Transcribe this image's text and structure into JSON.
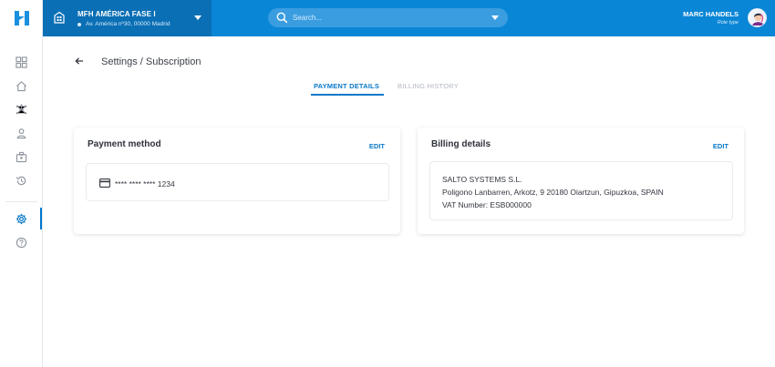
{
  "header": {
    "site_name": "MFH AMÉRICA FASE I",
    "site_address": "Av. América nº30, 00000 Madrid",
    "search_placeholder": "Search...",
    "user_name": "MARC HANDELS",
    "user_role": "Role type"
  },
  "sidebar": {
    "items": [
      {
        "icon": "grid-icon"
      },
      {
        "icon": "home-icon"
      },
      {
        "icon": "network-icon"
      },
      {
        "icon": "user-icon"
      },
      {
        "icon": "badge-icon"
      },
      {
        "icon": "history-icon"
      },
      {
        "icon": "gear-icon",
        "active": true
      },
      {
        "icon": "help-icon"
      }
    ]
  },
  "page": {
    "breadcrumb": "Settings / Subscription",
    "tabs": [
      {
        "label": "PAYMENT DETAILS",
        "active": true
      },
      {
        "label": "BILLING HISTORY",
        "active": false
      }
    ]
  },
  "payment": {
    "title": "Payment method",
    "edit_label": "EDIT",
    "card_number": "**** **** **** 1234"
  },
  "billing": {
    "title": "Billing details",
    "edit_label": "EDIT",
    "company": "SALTO SYSTEMS S.L.",
    "address": "Poligono Lanbarren, Arkotz, 9 20180 Oiartzun, Gipuzkoa, SPAIN",
    "vat": "VAT Number: ESB000000"
  },
  "colors": {
    "brand": "#0a86d6",
    "brand_dark": "#0a6fb5",
    "accent": "#0a78c8"
  }
}
